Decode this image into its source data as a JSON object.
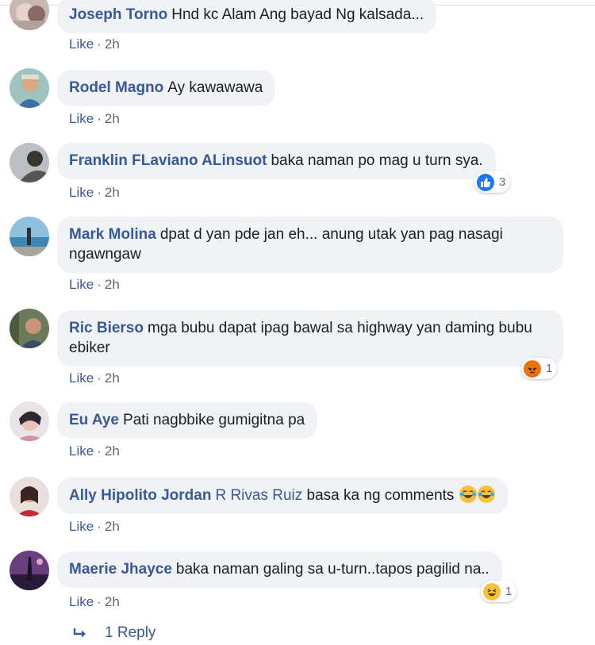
{
  "comments": [
    {
      "name": "Joseph Torno",
      "text": "Hnd kc Alam Ang bayad Ng kalsada...",
      "like": "Like",
      "time": "2h"
    },
    {
      "name": "Rodel Magno",
      "text": "Ay kawawawa",
      "like": "Like",
      "time": "2h"
    },
    {
      "name": "Franklin FLaviano ALinsuot",
      "text": "baka naman po mag u turn sya.",
      "like": "Like",
      "time": "2h",
      "reaction": {
        "type": "like",
        "count": "3"
      }
    },
    {
      "name": "Mark Molina",
      "text": "dpat d yan pde jan eh... anung utak yan pag nasagi ngawngaw",
      "like": "Like",
      "time": "2h"
    },
    {
      "name": "Ric Bierso",
      "text": "mga bubu dapat ipag bawal sa highway yan daming bubu ebiker",
      "like": "Like",
      "time": "2h",
      "reaction": {
        "type": "angry",
        "count": "1"
      }
    },
    {
      "name": "Eu Aye",
      "text": "Pati nagbbike gumigitna pa",
      "like": "Like",
      "time": "2h"
    },
    {
      "name": "Ally Hipolito Jordan",
      "mention": "R Rivas Ruiz",
      "text": "basa ka ng comments",
      "like": "Like",
      "time": "2h",
      "emojis": [
        "laughing-tears",
        "laughing-tears"
      ]
    },
    {
      "name": "Maerie Jhayce",
      "text": "baka naman galing sa u-turn..tapos pagilid na..",
      "like": "Like",
      "time": "2h",
      "reaction": {
        "type": "haha",
        "count": "1"
      }
    }
  ],
  "replies": {
    "label": "1 Reply"
  },
  "colors": {
    "link": "#385898",
    "bubble": "#f0f2f5",
    "meta": "#606770",
    "like_blue": "#1877f2",
    "angry": "#e9710f",
    "haha": "#f7c23b"
  }
}
